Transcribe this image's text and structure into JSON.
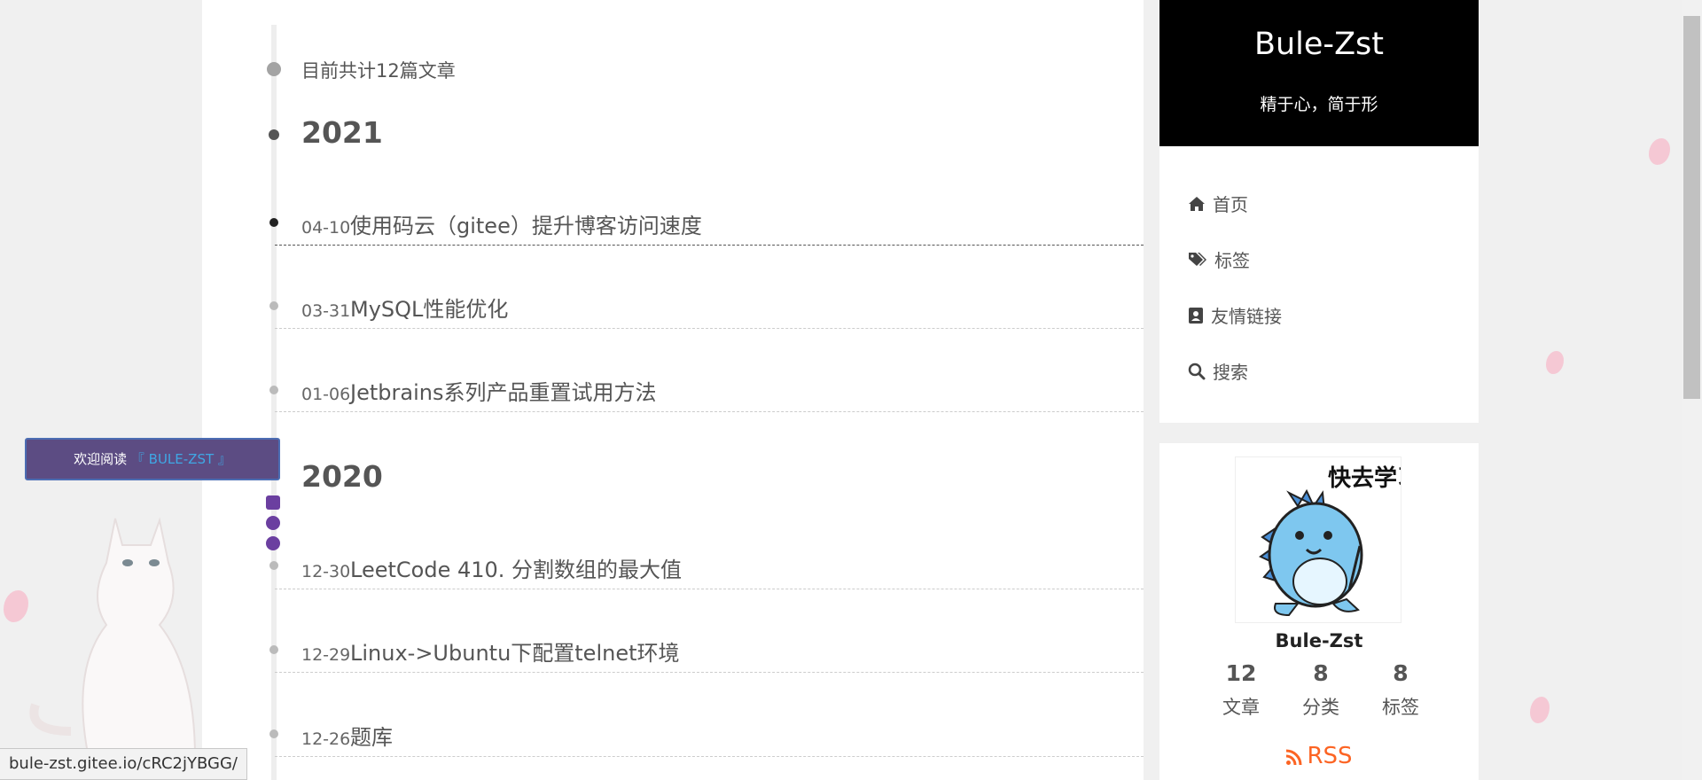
{
  "timeline": {
    "count_text": "目前共计12篇文章",
    "years": [
      {
        "year": "2021",
        "posts": [
          {
            "date": "04-10",
            "title": "使用码云（gitee）提升博客访问速度"
          },
          {
            "date": "03-31",
            "title": "MySQL性能优化"
          },
          {
            "date": "01-06",
            "title": "Jetbrains系列产品重置试用方法"
          }
        ]
      },
      {
        "year": "2020",
        "posts": [
          {
            "date": "12-30",
            "title": "LeetCode 410. 分割数组的最大值"
          },
          {
            "date": "12-29",
            "title": "Linux->Ubuntu下配置telnet环境"
          },
          {
            "date": "12-26",
            "title": "题库"
          }
        ]
      }
    ]
  },
  "sidebar": {
    "site_title": "Bule-Zst",
    "site_subtitle": "精于心，简于形",
    "menu": [
      {
        "label": "首页",
        "icon": "home-icon"
      },
      {
        "label": "标签",
        "icon": "tags-icon"
      },
      {
        "label": "友情链接",
        "icon": "address-book-icon"
      },
      {
        "label": "搜索",
        "icon": "search-icon"
      }
    ],
    "author": {
      "avatar_text": "快去学习",
      "name": "Bule-Zst",
      "stats": [
        {
          "value": "12",
          "label": "文章"
        },
        {
          "value": "8",
          "label": "分类"
        },
        {
          "value": "8",
          "label": "标签"
        }
      ]
    },
    "rss_label": "RSS"
  },
  "widget": {
    "welcome_prefix": "欢迎阅读",
    "welcome_highlight": "『 BULE-ZST 』"
  },
  "status_bar": {
    "url": "bule-zst.gitee.io/cRC2jYBGG/"
  },
  "colors": {
    "accent_rss": "#fc6423",
    "brand_bg": "#000000",
    "welcome_bg": "#5c4c83",
    "welcome_highlight": "#3fa7e4",
    "petal": "#f6c1cf"
  }
}
